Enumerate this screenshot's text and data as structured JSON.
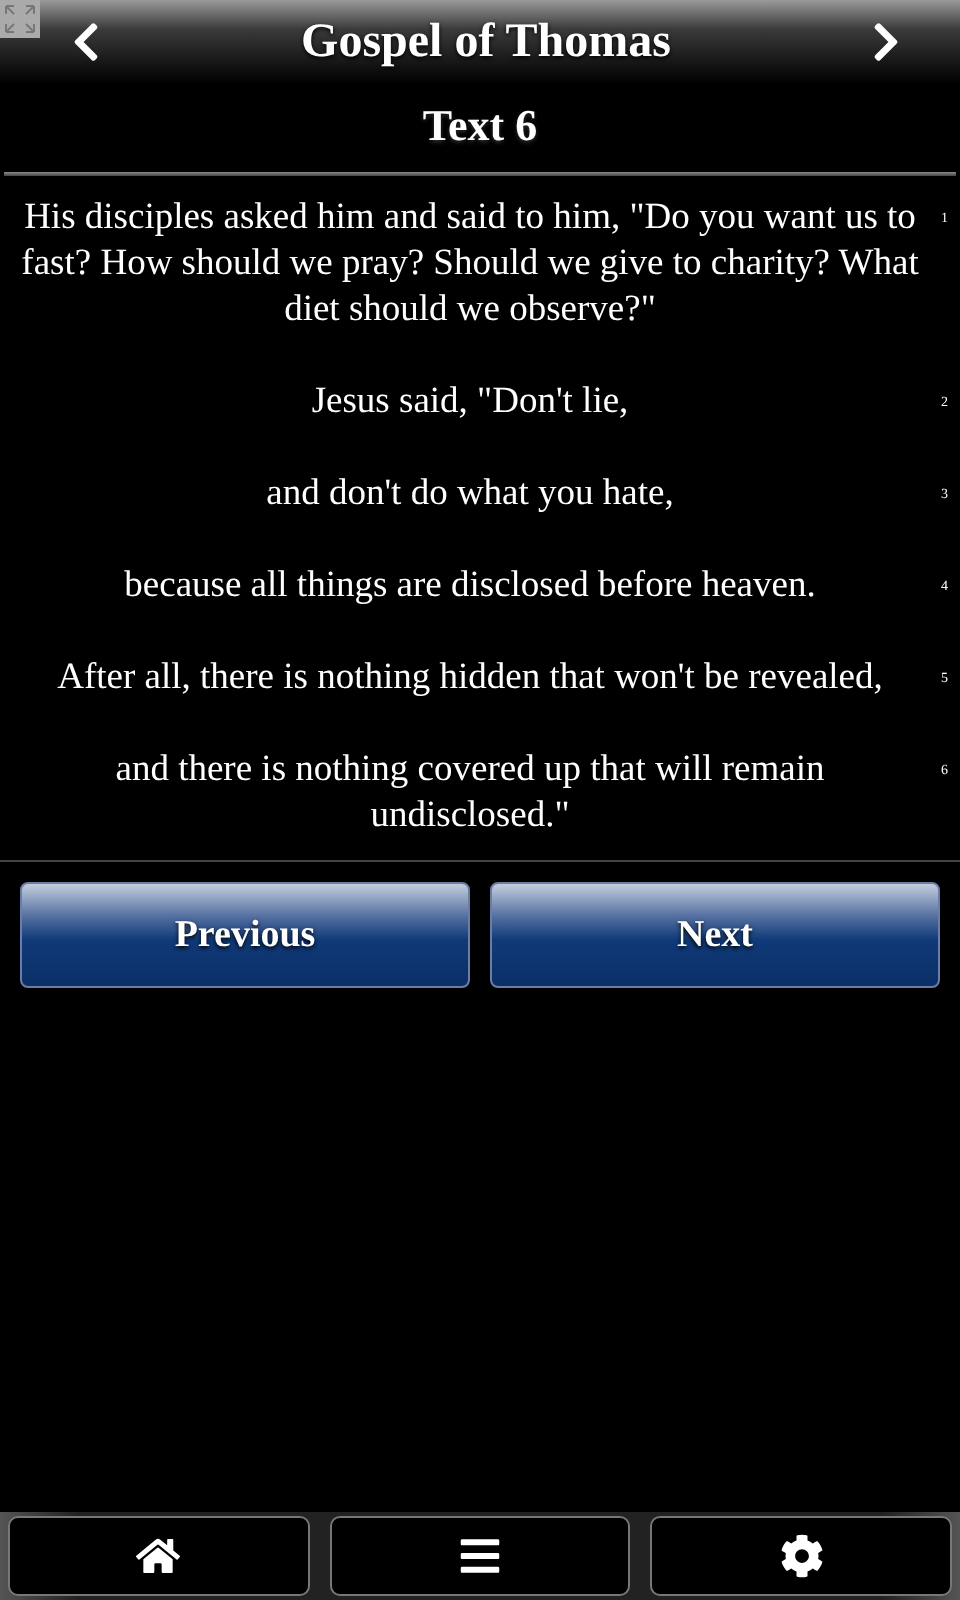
{
  "header": {
    "title": "Gospel of Thomas",
    "subtitle": "Text 6"
  },
  "verses": [
    {
      "text": "His disciples asked him and said to him, \"Do you want us to fast? How should we pray? Should we give to charity? What diet should we observe?\"",
      "number": "1"
    },
    {
      "text": "Jesus said, \"Don't lie,",
      "number": "2"
    },
    {
      "text": "and don't do what you hate,",
      "number": "3"
    },
    {
      "text": "because all things are disclosed before heaven.",
      "number": "4"
    },
    {
      "text": "After all, there is nothing hidden that won't be revealed,",
      "number": "5"
    },
    {
      "text": "and there is nothing covered up that will remain undisclosed.\"",
      "number": "6"
    }
  ],
  "buttons": [
    "Previous",
    "Next"
  ],
  "footer": [
    {
      "kind": "home"
    },
    {
      "kind": "menu"
    },
    {
      "kind": "settings"
    }
  ]
}
